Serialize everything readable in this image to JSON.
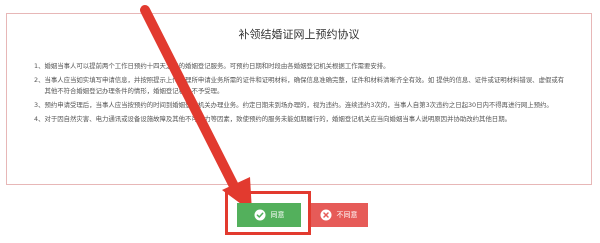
{
  "agreement": {
    "title": "补领结婚证网上预约协议",
    "clauses": [
      {
        "num": "1、",
        "text": "婚姻当事人可以提前两个工作日预约十四天之内的婚姻登记服务。可预约日期和时段由各婚姻登记机关根据工作需要安排。"
      },
      {
        "num": "2、",
        "text": "当事人应当如实填写申请信息，并按照提示上传办理所申请业务所需的证件和证明材料，确保信息准确完整，证件和材料清晰齐全有效。如 提供的信息、证件或证明材料错误、虚假或有其他不符合婚姻登记办理条件的情形，婚姻登记机关不予受理。"
      },
      {
        "num": "3、",
        "text": "预约申请受理后，当事人应当按预约的时间到婚姻登记机关办理业务。约定日期未到场办理的，视为违约。连续违约3次的，当事人自第3次违约之日起30日内不得再进行网上预约。"
      },
      {
        "num": "4、",
        "text": "对于因自然灾害、电力通讯或设备设施故障及其他不可抗力等因素，致使预约的服务未能如期履行的，婚姻登记机关应当向婚姻当事人说明原因并协助改约其他日期。"
      }
    ]
  },
  "buttons": {
    "agree": {
      "label": "同意",
      "icon": "check-circle-icon",
      "color": "#53b05c"
    },
    "disagree": {
      "label": "不同意",
      "icon": "x-circle-icon",
      "color": "#e65b58"
    }
  },
  "annotation": {
    "color": "#e23a2f"
  }
}
